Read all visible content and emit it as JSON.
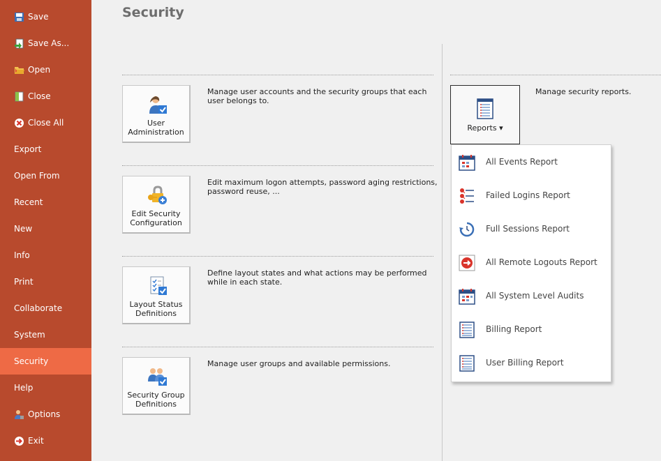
{
  "sidebar": {
    "items": [
      {
        "label": "Save",
        "icon": "save-icon"
      },
      {
        "label": "Save As...",
        "icon": "save-as-icon"
      },
      {
        "label": "Open",
        "icon": "open-folder-icon"
      },
      {
        "label": "Close",
        "icon": "close-document-icon"
      },
      {
        "label": "Close All",
        "icon": "close-all-icon"
      },
      {
        "label": "Export"
      },
      {
        "label": "Open From"
      },
      {
        "label": "Recent"
      },
      {
        "label": "New"
      },
      {
        "label": "Info"
      },
      {
        "label": "Print"
      },
      {
        "label": "Collaborate"
      },
      {
        "label": "System"
      },
      {
        "label": "Security"
      },
      {
        "label": "Help"
      },
      {
        "label": "Options",
        "icon": "options-user-icon"
      },
      {
        "label": "Exit",
        "icon": "exit-icon"
      }
    ],
    "active": "Security"
  },
  "page": {
    "title": "Security"
  },
  "tiles": [
    {
      "label_line1": "User",
      "label_line2": "Administration",
      "icon": "user-admin-icon",
      "description": "Manage user accounts and the security groups that each user belongs to."
    },
    {
      "label_line1": "Edit Security",
      "label_line2": "Configuration",
      "icon": "lock-key-icon",
      "description": "Edit maximum logon attempts, password aging restrictions, password reuse, ..."
    },
    {
      "label_line1": "Layout Status",
      "label_line2": "Definitions",
      "icon": "checklist-icon",
      "description": "Define layout states and what actions may be performed while in each state."
    },
    {
      "label_line1": "Security Group",
      "label_line2": "Definitions",
      "icon": "user-group-icon",
      "description": "Manage user groups and available permissions."
    }
  ],
  "reports": {
    "button_label": "Reports",
    "description": "Manage security reports.",
    "menu": [
      {
        "label": "All Events Report",
        "icon": "calendar-report-icon"
      },
      {
        "label": "Failed Logins Report",
        "icon": "failed-logins-icon"
      },
      {
        "label": "Full Sessions Report",
        "icon": "refresh-report-icon"
      },
      {
        "label": "All Remote Logouts Report",
        "icon": "logout-arrow-icon"
      },
      {
        "label": "All System Level Audits",
        "icon": "audit-calendar-icon"
      },
      {
        "label": "Billing Report",
        "icon": "billing-list-icon"
      },
      {
        "label": "User Billing Report",
        "icon": "user-billing-list-icon"
      }
    ]
  },
  "colors": {
    "sidebar_bg": "#b84a2d",
    "sidebar_active": "#ee6a45",
    "page_bg": "#f0f0f0"
  }
}
